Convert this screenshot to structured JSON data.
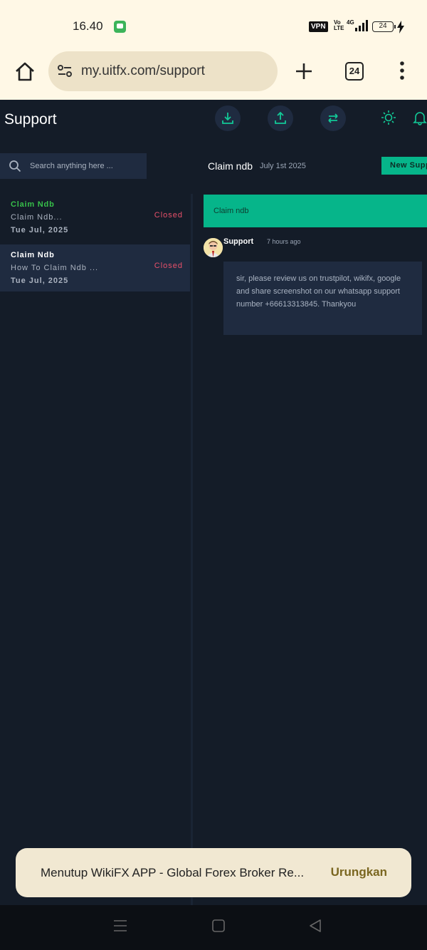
{
  "status": {
    "time": "16.40",
    "vpn": "VPN",
    "volte_top": "Vo",
    "volte_bottom": "LTE",
    "network": "4G",
    "battery": "24"
  },
  "browser": {
    "url": "my.uitfx.com/support",
    "tab_count": "24"
  },
  "header": {
    "title": "Support",
    "icons": [
      "download-icon",
      "upload-icon",
      "transfer-icon",
      "sun-icon",
      "bell-icon"
    ]
  },
  "search": {
    "placeholder": "Search anything here ..."
  },
  "conversation": {
    "title": "Claim ndb",
    "date": "July 1st 2025",
    "new_button": "New Support"
  },
  "tickets": [
    {
      "title": "Claim Ndb",
      "subtitle": "Claim Ndb...",
      "date": "Tue Jul, 2025",
      "status": "Closed",
      "title_color": "#37c04a"
    },
    {
      "title": "Claim Ndb",
      "subtitle": "How To Claim Ndb ...",
      "date": "Tue Jul, 2025",
      "status": "Closed",
      "title_color": "#ffffff"
    }
  ],
  "thread": {
    "subject": "Claim ndb",
    "sender": "Support",
    "time": "7 hours ago",
    "message": "sir, please review us on trustpilot, wikifx, google and share screenshot on our whatsapp support number +66613313845. Thankyou"
  },
  "toast": {
    "text": "Menutup WikiFX APP - Global Forex Broker Re...",
    "action": "Urungkan"
  },
  "colors": {
    "accent": "#06b58a",
    "background": "#141c28",
    "panel": "#1f2b40",
    "closed": "#e9506a"
  }
}
